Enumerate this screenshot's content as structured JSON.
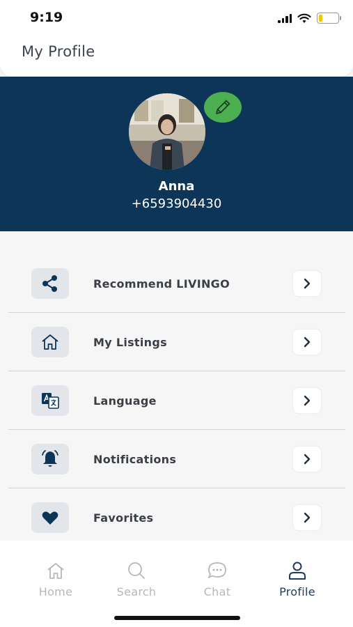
{
  "status_bar": {
    "time": "9:19",
    "battery_level": 0.2,
    "battery_color": "#f2c400"
  },
  "header": {
    "title": "My Profile"
  },
  "profile": {
    "name": "Anna",
    "phone": "+6593904430",
    "edit_icon": "pencil-icon",
    "banner_color": "#0c3557",
    "edit_badge_color": "#4caf50"
  },
  "menu": {
    "items": [
      {
        "label": "Recommend LIVINGO",
        "icon": "share-icon"
      },
      {
        "label": "My Listings",
        "icon": "home-icon"
      },
      {
        "label": "Language",
        "icon": "translate-icon"
      },
      {
        "label": "Notifications",
        "icon": "bell-icon"
      },
      {
        "label": "Favorites",
        "icon": "heart-icon"
      }
    ],
    "chevron_icon": "chevron-right-icon"
  },
  "bottom_nav": {
    "items": [
      {
        "label": "Home",
        "icon": "home-outline-icon",
        "active": false
      },
      {
        "label": "Search",
        "icon": "search-icon",
        "active": false
      },
      {
        "label": "Chat",
        "icon": "chat-icon",
        "active": false
      },
      {
        "label": "Profile",
        "icon": "user-icon",
        "active": true
      }
    ],
    "active_color": "#1e3a5f",
    "inactive_color": "#b7b7b7"
  }
}
